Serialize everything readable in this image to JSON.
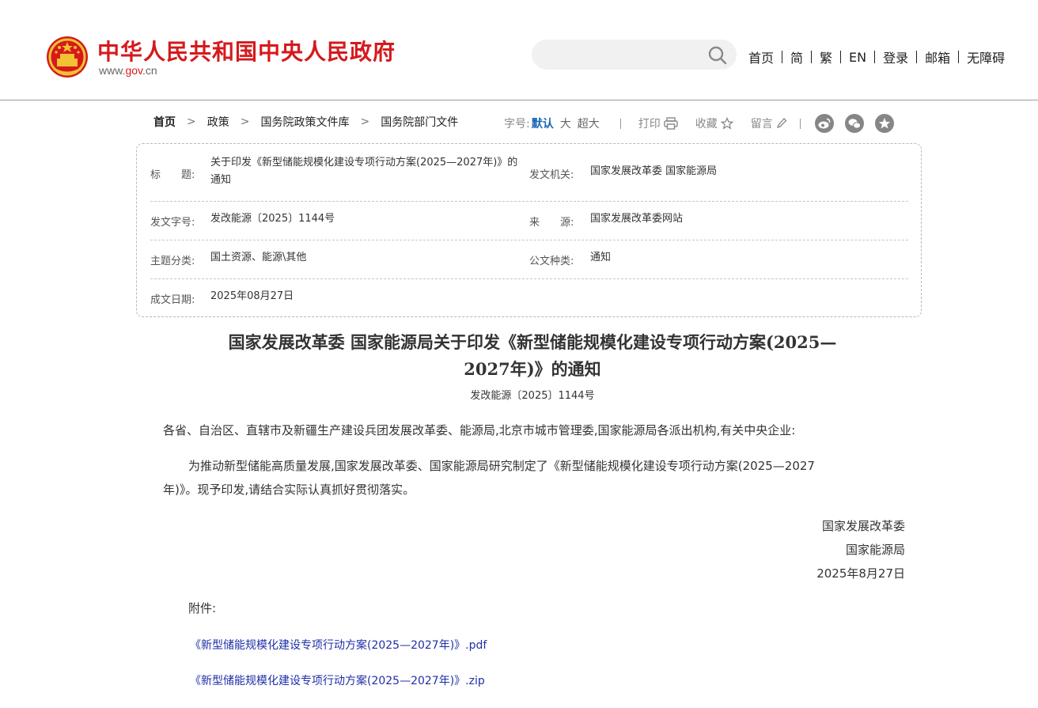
{
  "header": {
    "site_title": "中华人民共和国中央人民政府",
    "domain_prefix": "www.",
    "domain_main": "gov",
    "domain_suffix": ".cn",
    "search_placeholder": "",
    "nav": [
      "首页",
      "简",
      "繁",
      "EN",
      "登录",
      "邮箱",
      "无障碍"
    ]
  },
  "breadcrumb": [
    "首页",
    "政策",
    "国务院政策文件库",
    "国务院部门文件"
  ],
  "toolbar": {
    "font_size_label": "字号:",
    "font_sizes": [
      "默认",
      "大",
      "超大"
    ],
    "print": "打印",
    "favorite": "收藏",
    "comment": "留言",
    "share_icons": [
      "weibo-icon",
      "wechat-icon",
      "favorite-star-icon"
    ]
  },
  "info": {
    "title_label": "标　　题:",
    "title_value": "关于印发《新型储能规模化建设专项行动方案(2025—2027年)》的通知",
    "issuer_label": "发文机关:",
    "issuer_value": "国家发展改革委 国家能源局",
    "docno_label": "发文字号:",
    "docno_value": "发改能源〔2025〕1144号",
    "source_label": "来　　源:",
    "source_value": "国家发展改革委网站",
    "topic_label": "主题分类:",
    "topic_value": "国土资源、能源\\其他",
    "type_label": "公文种类:",
    "type_value": "通知",
    "date_label": "成文日期:",
    "date_value": "2025年08月27日"
  },
  "article": {
    "title_line1": "国家发展改革委 国家能源局关于印发《新型储能规模化建设专项行动方案(2025—",
    "title_line2": "2027年)》的通知",
    "doc_number": "发改能源〔2025〕1144号",
    "salutation": "各省、自治区、直辖市及新疆生产建设兵团发展改革委、能源局,北京市城市管理委,国家能源局各派出机构,有关中央企业:",
    "body_line1": "为推动新型储能高质量发展,国家发展改革委、国家能源局研究制定了《新型储能规模化建设专项行动方案(2025—2027",
    "body_line2": "年)》。现予印发,请结合实际认真抓好贯彻落实。",
    "signature": [
      "国家发展改革委",
      "国家能源局",
      "2025年8月27日"
    ],
    "attachments_label": "附件:",
    "attachments": [
      "《新型储能规模化建设专项行动方案(2025—2027年)》.pdf",
      "《新型储能规模化建设专项行动方案(2025—2027年)》.zip"
    ]
  },
  "colors": {
    "brand_red": "#d6191d",
    "link_blue": "#1f2fa8",
    "active_blue": "#1a66b5"
  }
}
